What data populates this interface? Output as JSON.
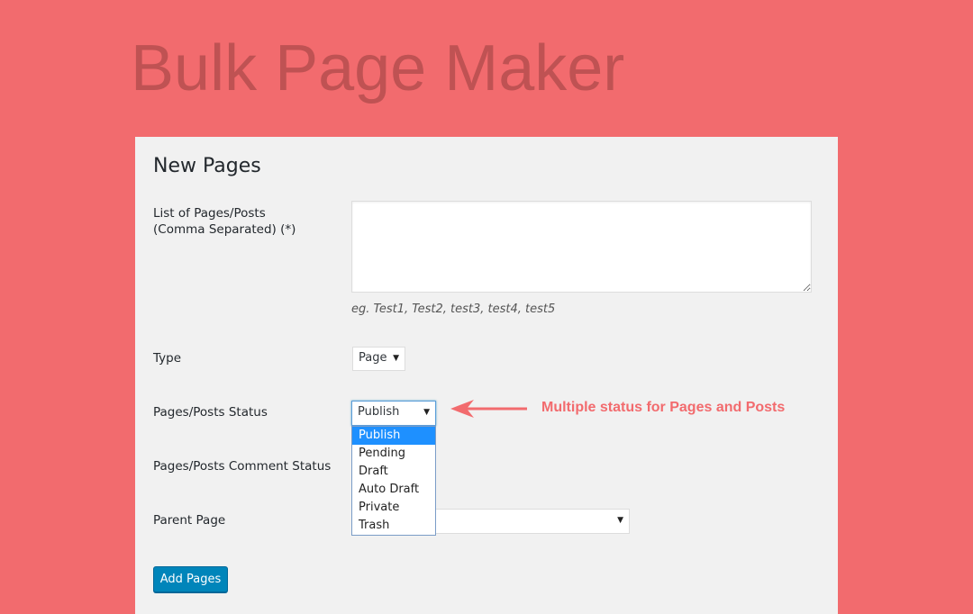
{
  "banner": {
    "title": "Bulk Page Maker"
  },
  "panel": {
    "title": "New Pages",
    "pages_list": {
      "label_line1": "List of Pages/Posts",
      "label_line2": "(Comma Separated) (*)",
      "value": "",
      "hint": "eg. Test1, Test2, test3, test4, test5"
    },
    "type": {
      "label": "Type",
      "value": "Page"
    },
    "status": {
      "label": "Pages/Posts Status",
      "value": "Publish",
      "options": [
        "Publish",
        "Pending",
        "Draft",
        "Auto Draft",
        "Private",
        "Trash"
      ],
      "highlighted_option": "Publish"
    },
    "comment_status": {
      "label": "Pages/Posts Comment Status"
    },
    "parent_page": {
      "label": "Parent Page",
      "value": ""
    },
    "submit_label": "Add Pages"
  },
  "annotation": {
    "text": "Multiple status for Pages and Posts",
    "color": "#f26b6e"
  },
  "colors": {
    "background": "#f26b6e",
    "title": "#bf5253",
    "button": "#0085ba",
    "highlight": "#1e90ff"
  }
}
